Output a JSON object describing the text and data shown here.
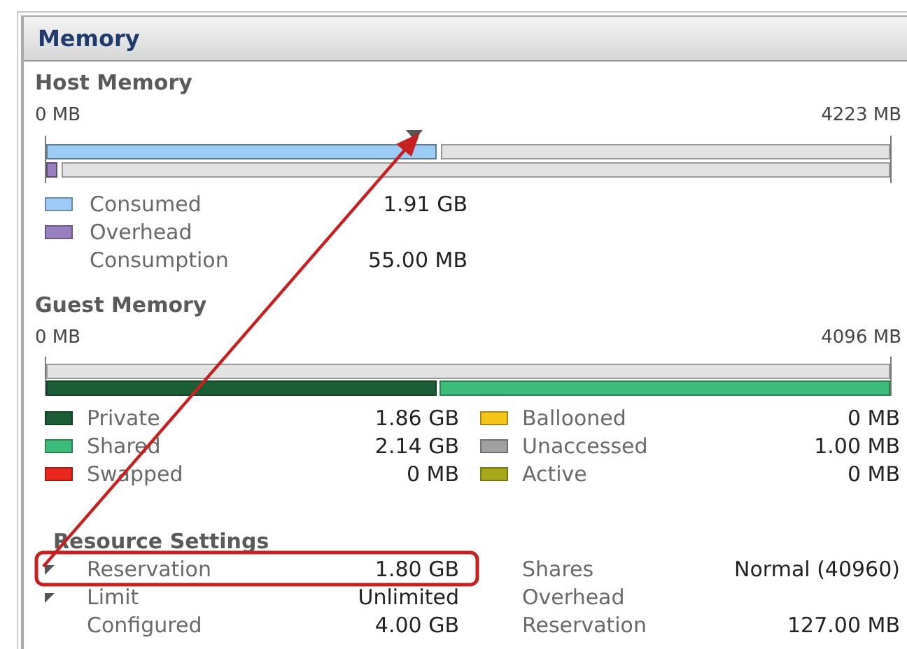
{
  "panel": {
    "title": "Memory"
  },
  "host_memory": {
    "title": "Host Memory",
    "scale_min": "0 MB",
    "scale_max": "4223 MB",
    "reservation_marker": {
      "level": 0.436
    },
    "items": [
      {
        "label": "Consumed",
        "value": "1.91 GB",
        "color": "#9ccbf5",
        "level": 0.463
      },
      {
        "label": "Overhead Consumption",
        "value": "55.00 MB",
        "color": "#9a7fc0",
        "level": 0.013
      }
    ]
  },
  "guest_memory": {
    "title": "Guest Memory",
    "scale_min": "0 MB",
    "scale_max": "4096 MB",
    "columns": [
      {
        "items": [
          {
            "label": "Private",
            "value": "1.86 GB",
            "color": "#1b5e35",
            "level": 0.465
          },
          {
            "label": "Shared",
            "value": "2.14 GB",
            "color": "#3dbb78",
            "level": 0.535
          },
          {
            "label": "Swapped",
            "value": "0 MB",
            "color": "#e8281c"
          }
        ]
      },
      {
        "items": [
          {
            "label": "Ballooned",
            "value": "0 MB",
            "color": "#f5c518"
          },
          {
            "label": "Unaccessed",
            "value": "1.00 MB",
            "color": "#a0a0a0"
          },
          {
            "label": "Active",
            "value": "0 MB",
            "color": "#a8a81a"
          }
        ]
      }
    ]
  },
  "resource_settings": {
    "title": "Resource Settings",
    "columns": [
      {
        "rows": [
          {
            "label": "Reservation",
            "value": "1.80 GB",
            "marker": true
          },
          {
            "label": "Limit",
            "value": "Unlimited",
            "marker": true
          },
          {
            "label": "Configured",
            "value": "4.00 GB",
            "marker": false
          }
        ]
      },
      {
        "rows": [
          {
            "label": "Shares",
            "value": "Normal (40960)",
            "marker": false
          },
          {
            "label": "Overhead Reservation",
            "value": "127.00 MB",
            "marker": false
          }
        ]
      }
    ]
  }
}
